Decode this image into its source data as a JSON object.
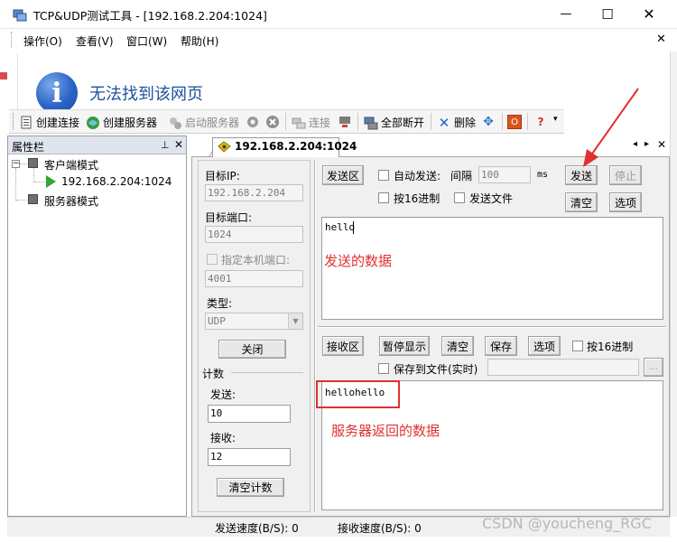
{
  "window": {
    "title": "TCP&UDP测试工具 - [192.168.2.204:1024]",
    "minimize_glyph": "—",
    "maximize_glyph": "☐",
    "close_glyph": "✕"
  },
  "menu": {
    "items": [
      "操作(O)",
      "查看(V)",
      "窗口(W)",
      "帮助(H)"
    ],
    "close_glyph": "✕"
  },
  "browser_panel": {
    "message": "无法找到该网页",
    "info_glyph": "i"
  },
  "toolbar": {
    "items": [
      {
        "label": "创建连接",
        "icon": "connect-icon",
        "enabled": true
      },
      {
        "label": "创建服务器",
        "icon": "server-icon",
        "enabled": true
      },
      {
        "label": "启动服务器",
        "icon": "start-server-icon",
        "enabled": false
      },
      {
        "label": "连接",
        "icon": "link-icon",
        "enabled": false
      },
      {
        "label": "全部断开",
        "icon": "disconnect-all-icon",
        "enabled": true
      },
      {
        "label": "删除",
        "icon": "delete-icon",
        "enabled": true
      }
    ]
  },
  "property_panel": {
    "title": "属性栏",
    "pin_glyph": "⊥",
    "close_glyph": "✕",
    "tree": {
      "client_mode": "客户端模式",
      "client_connection": "192.168.2.204:1024",
      "server_mode": "服务器模式"
    }
  },
  "connection_tab": {
    "label": "192.168.2.204:1024",
    "nav_glyphs": [
      "◂",
      "▸",
      "✕"
    ]
  },
  "settings": {
    "target_ip_label": "目标IP:",
    "target_ip_value": "192.168.2.204",
    "target_port_label": "目标端口:",
    "target_port_value": "1024",
    "local_port_label": "指定本机端口:",
    "local_port_value": "4001",
    "type_label": "类型:",
    "type_value": "UDP",
    "close_button": "关闭",
    "count_label": "计数",
    "sent_label": "发送:",
    "sent_value": "10",
    "received_label": "接收:",
    "received_value": "12",
    "clear_count_button": "清空计数"
  },
  "send_area": {
    "title_button": "发送区",
    "auto_send_label": "自动发送:",
    "interval_label": "间隔",
    "interval_value": "100",
    "interval_unit": "ms",
    "send_button": "发送",
    "stop_button": "停止",
    "hex_label": "按16进制",
    "send_file_label": "发送文件",
    "clear_button": "清空",
    "options_button": "选项",
    "content": "hello",
    "annotation": "发送的数据"
  },
  "receive_area": {
    "title_button": "接收区",
    "pause_button": "暂停显示",
    "clear_button": "清空",
    "save_button": "保存",
    "options_button": "选项",
    "hex_label": "按16进制",
    "save_to_file_label": "保存到文件(实时)",
    "browse_button": "...",
    "content": "hellohello",
    "annotation": "服务器返回的数据"
  },
  "status": {
    "send_speed": "发送速度(B/S): 0",
    "receive_speed": "接收速度(B/S): 0"
  },
  "watermark": "CSDN @youcheng_RGC",
  "colors": {
    "annotation_red": "#e03030",
    "browser_blue": "#1e4f9e",
    "tab_header": "#dfe5ee",
    "panel_bg": "#f0f0f0"
  }
}
